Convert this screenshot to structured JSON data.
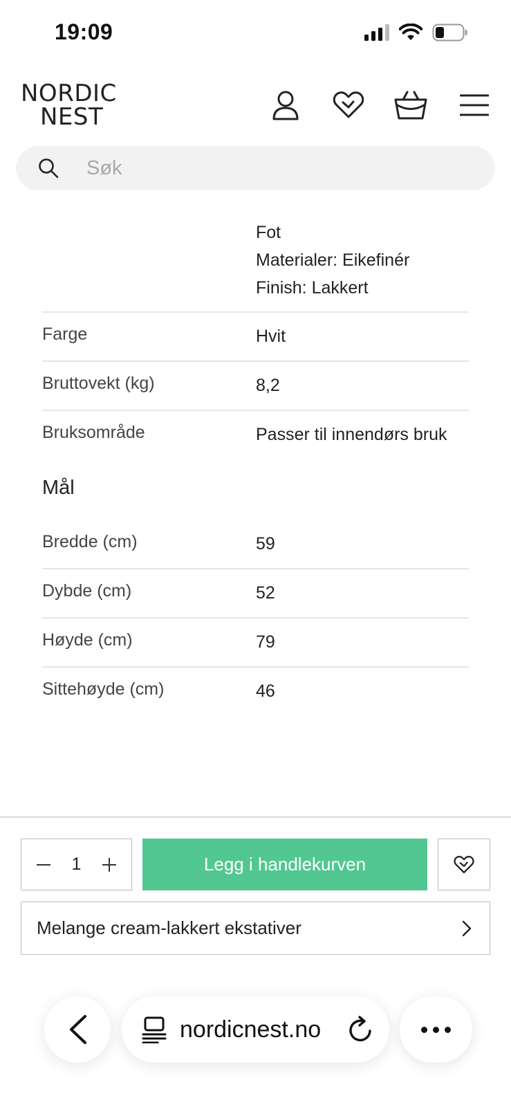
{
  "status_bar": {
    "time": "19:09"
  },
  "header": {
    "logo_line1": "NORDIC",
    "logo_line2": "NEST",
    "icons": [
      "user-icon",
      "heart-icon",
      "basket-icon",
      "menu-icon"
    ]
  },
  "search": {
    "placeholder": "Søk",
    "value": ""
  },
  "specs": {
    "top_lines": [
      "Fot",
      "Materialer: Eikefinér",
      "Finish: Lakkert"
    ],
    "rows": [
      {
        "label": "Farge",
        "value": "Hvit"
      },
      {
        "label": "Bruttovekt (kg)",
        "value": "8,2"
      },
      {
        "label": "Bruksområde",
        "value": "Passer til innendørs bruk"
      }
    ],
    "dimensions_title": "Mål",
    "dimensions": [
      {
        "label": "Bredde (cm)",
        "value": "59"
      },
      {
        "label": "Dybde (cm)",
        "value": "52"
      },
      {
        "label": "Høyde (cm)",
        "value": "79"
      },
      {
        "label": "Sittehøyde (cm)",
        "value": "46"
      }
    ]
  },
  "purchase": {
    "quantity": "1",
    "add_to_cart_label": "Legg i handlekurven",
    "variant_label": "Melange cream-lakkert ekstativer",
    "accent_color": "#52c791"
  },
  "browser": {
    "url": "nordicnest.no"
  }
}
